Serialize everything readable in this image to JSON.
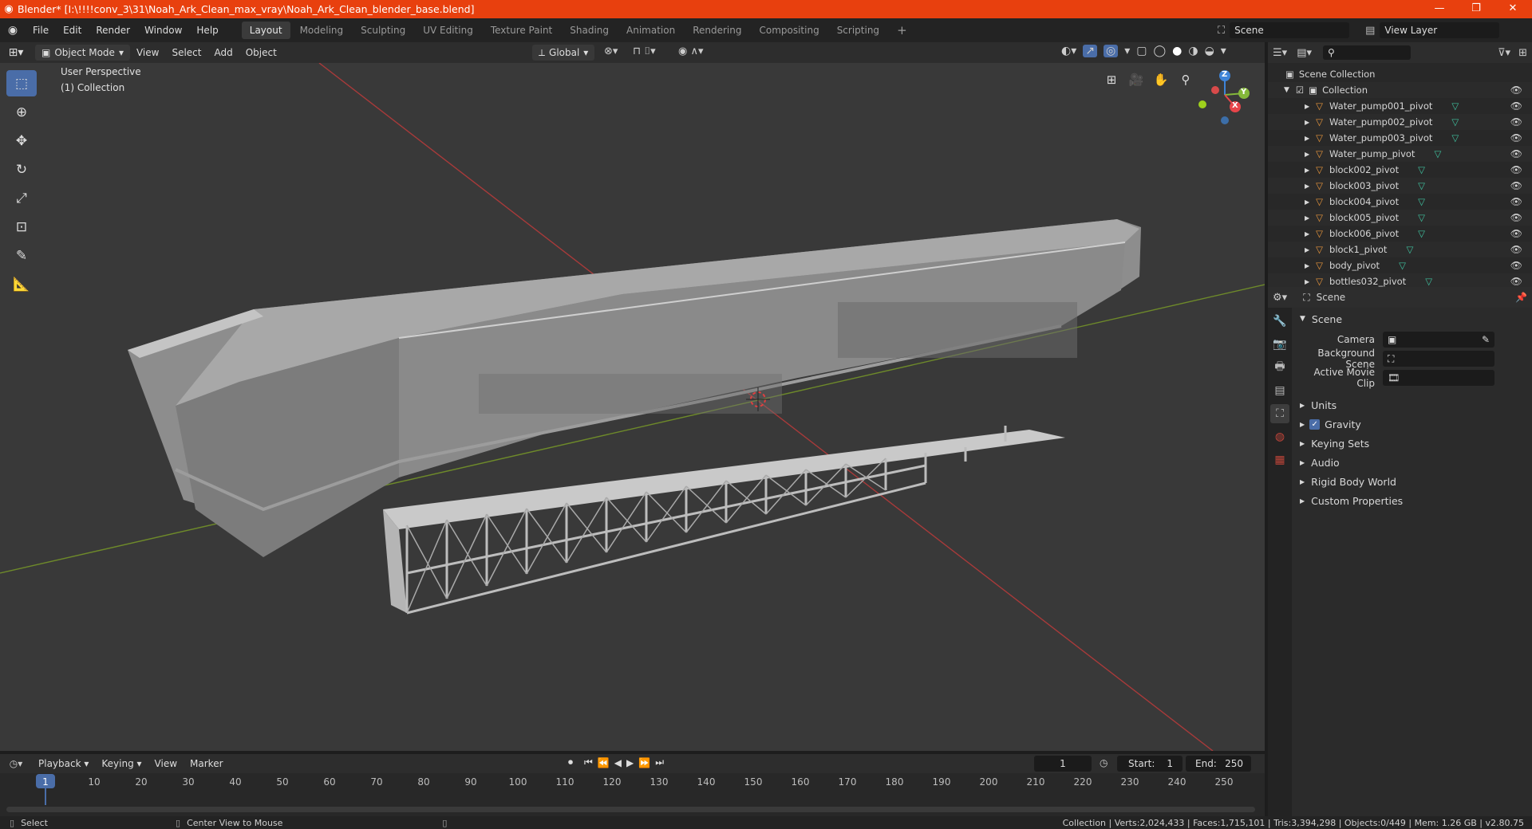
{
  "window": {
    "title": "Blender* [I:\\!!!!conv_3\\31\\Noah_Ark_Clean_max_vray\\Noah_Ark_Clean_blender_base.blend]",
    "minimize": "—",
    "restore": "❐",
    "close": "✕"
  },
  "menu": [
    "File",
    "Edit",
    "Render",
    "Window",
    "Help"
  ],
  "workspaces": [
    "Layout",
    "Modeling",
    "Sculpting",
    "UV Editing",
    "Texture Paint",
    "Shading",
    "Animation",
    "Rendering",
    "Compositing",
    "Scripting"
  ],
  "active_workspace": "Layout",
  "scene_field": "Scene",
  "view_layer_field": "View Layer",
  "viewport_header": {
    "mode": "Object Mode",
    "menus": [
      "View",
      "Select",
      "Add",
      "Object"
    ],
    "orientation": "Global"
  },
  "viewport": {
    "perspective_label": "User Perspective",
    "collection_label": "(1) Collection",
    "axis_x": "X",
    "axis_y": "Y",
    "axis_z": "Z"
  },
  "outliner": {
    "root": "Scene Collection",
    "collection": "Collection",
    "items": [
      "Water_pump001_pivot",
      "Water_pump002_pivot",
      "Water_pump003_pivot",
      "Water_pump_pivot",
      "block002_pivot",
      "block003_pivot",
      "block004_pivot",
      "block005_pivot",
      "block006_pivot",
      "block1_pivot",
      "body_pivot",
      "bottles032_pivot"
    ]
  },
  "properties": {
    "breadcrumb": "Scene",
    "panel_title": "Scene",
    "camera_label": "Camera",
    "background_scene_label": "Background Scene",
    "active_movie_clip_label": "Active Movie Clip",
    "sections": [
      "Units",
      "Gravity",
      "Keying Sets",
      "Audio",
      "Rigid Body World",
      "Custom Properties"
    ],
    "gravity_checked": true
  },
  "timeline": {
    "menus": [
      "Playback",
      "Keying",
      "View",
      "Marker"
    ],
    "current_frame": "1",
    "start_label": "Start:",
    "start_value": "1",
    "end_label": "End:",
    "end_value": "250",
    "ruler": [
      "1",
      "10",
      "20",
      "30",
      "40",
      "50",
      "60",
      "70",
      "80",
      "90",
      "100",
      "110",
      "120",
      "130",
      "140",
      "150",
      "160",
      "170",
      "180",
      "190",
      "200",
      "210",
      "220",
      "230",
      "240",
      "250"
    ]
  },
  "statusbar": {
    "select": "Select",
    "center_view": "Center View to Mouse",
    "stats": "Collection | Verts:2,024,433 | Faces:1,715,101 | Tris:3,394,298 | Objects:0/449 | Mem: 1.26 GB | v2.80.75"
  },
  "colors": {
    "title_bar": "#e8400e",
    "active_tool": "#4a6da8",
    "object_icon": "#e8963c",
    "mesh_icon": "#3fc09e",
    "axis_x": "#e8454a",
    "axis_y": "#84b83a",
    "axis_z": "#3e84d8"
  }
}
